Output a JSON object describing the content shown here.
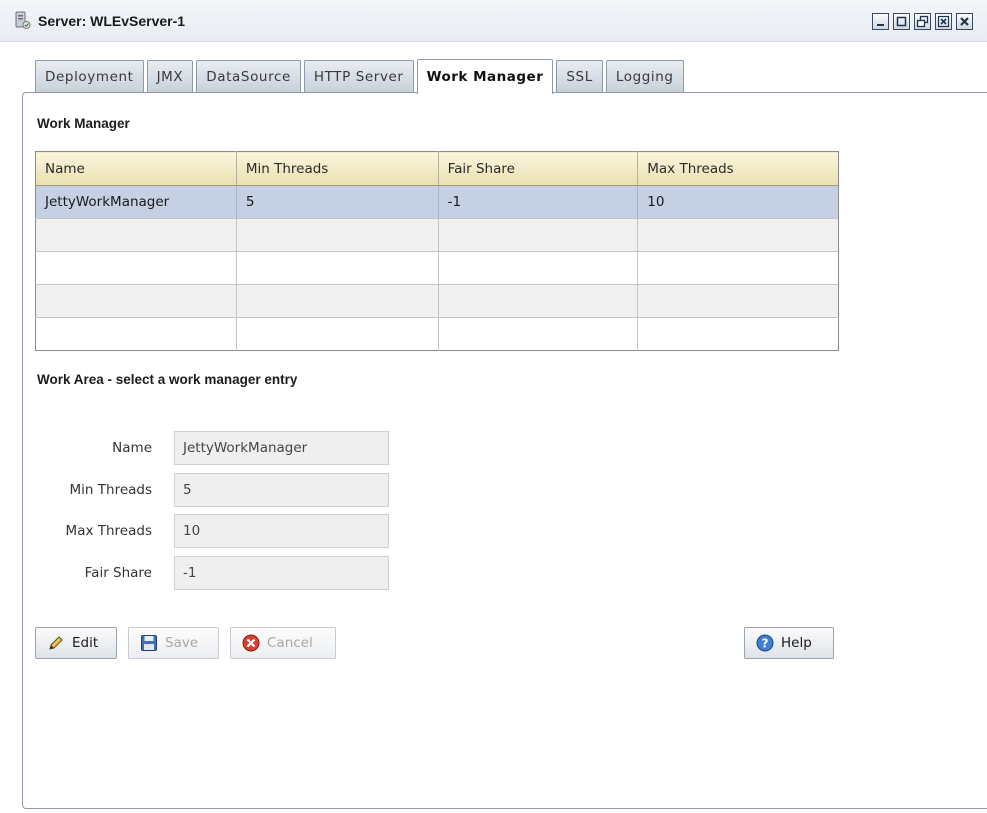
{
  "window": {
    "title": "Server: WLEvServer-1",
    "controls": [
      "minimize-icon",
      "maximize-icon",
      "restore-icon",
      "dock-icon",
      "close-icon"
    ]
  },
  "tabs": [
    {
      "label": "Deployment",
      "active": false
    },
    {
      "label": "JMX",
      "active": false
    },
    {
      "label": "DataSource",
      "active": false
    },
    {
      "label": "HTTP Server",
      "active": false
    },
    {
      "label": "Work Manager",
      "active": true
    },
    {
      "label": "SSL",
      "active": false
    },
    {
      "label": "Logging",
      "active": false
    }
  ],
  "work_manager": {
    "section_title": "Work Manager",
    "columns": [
      "Name",
      "Min Threads",
      "Fair Share",
      "Max Threads"
    ],
    "rows": [
      [
        "JettyWorkManager",
        "5",
        "-1",
        "10"
      ],
      [
        "",
        "",
        "",
        ""
      ],
      [
        "",
        "",
        "",
        ""
      ],
      [
        "",
        "",
        "",
        ""
      ],
      [
        "",
        "",
        "",
        ""
      ]
    ]
  },
  "work_area": {
    "title": "Work Area - select a work manager entry",
    "fields": [
      {
        "label": "Name",
        "value": "JettyWorkManager"
      },
      {
        "label": "Min Threads",
        "value": "5"
      },
      {
        "label": "Max Threads",
        "value": "10"
      },
      {
        "label": "Fair Share",
        "value": "-1"
      }
    ]
  },
  "buttons": {
    "edit": "Edit",
    "save": "Save",
    "cancel": "Cancel",
    "help": "Help"
  },
  "colors": {
    "selected_row": "#c5d0e3",
    "header_bg": "#efe7c3",
    "tab_border": "#8e9aa8"
  }
}
